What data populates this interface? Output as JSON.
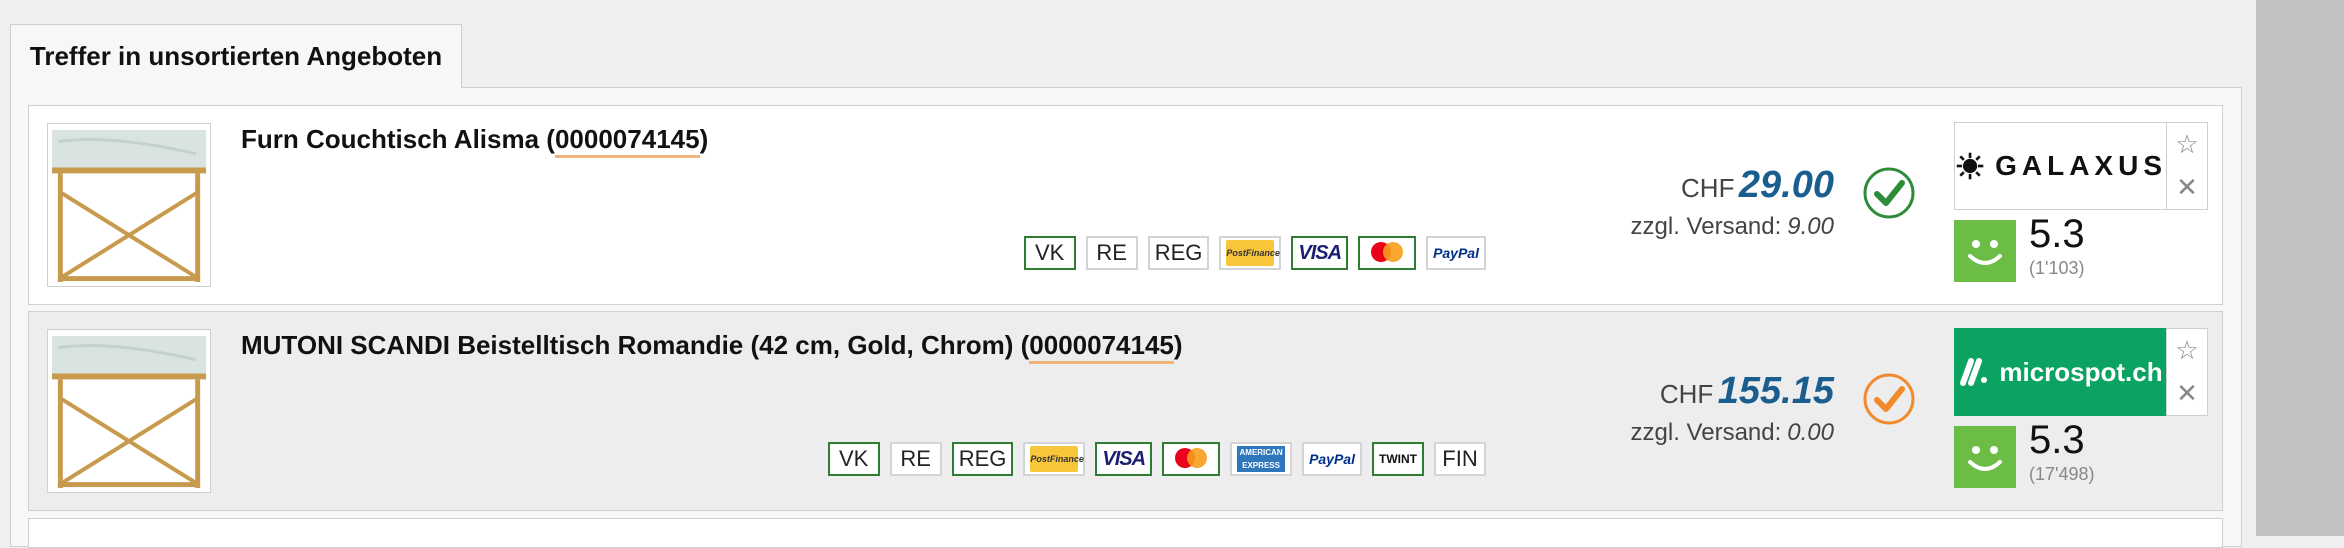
{
  "tab": {
    "label": "Treffer in unsortierten Angeboten"
  },
  "offers": [
    {
      "title": "Furn Couchtisch Alisma (",
      "ean": "0000074145",
      "title_end": ")",
      "payments": [
        {
          "label": "VK",
          "accepted": true
        },
        {
          "label": "RE",
          "accepted": false
        },
        {
          "label": "REG",
          "accepted": false
        },
        {
          "label": "PostFinance",
          "accepted": false
        },
        {
          "label": "VISA",
          "accepted": true
        },
        {
          "label": "mastercard",
          "accepted": true
        },
        {
          "label": "PayPal",
          "accepted": false
        }
      ],
      "currency": "CHF",
      "price": "29.00",
      "shipping_label": "zzgl. Versand:",
      "shipping_value": "9.00",
      "check_color": "#2e8b3a",
      "shop": "GALAXUS",
      "score": "5.3",
      "count": "(1'103)"
    },
    {
      "title": "MUTONI SCANDI Beistelltisch Romandie (42 cm, Gold, Chrom) (",
      "ean": "0000074145",
      "title_end": ")",
      "payments": [
        {
          "label": "VK",
          "accepted": true
        },
        {
          "label": "RE",
          "accepted": false
        },
        {
          "label": "REG",
          "accepted": true
        },
        {
          "label": "PostFinance",
          "accepted": false
        },
        {
          "label": "VISA",
          "accepted": true
        },
        {
          "label": "mastercard",
          "accepted": true
        },
        {
          "label": "AMERICAN EXPRESS",
          "accepted": false
        },
        {
          "label": "PayPal",
          "accepted": false
        },
        {
          "label": "TWINT",
          "accepted": true
        },
        {
          "label": "FIN",
          "accepted": false
        }
      ],
      "currency": "CHF",
      "price": "155.15",
      "shipping_label": "zzgl. Versand:",
      "shipping_value": "0.00",
      "check_color": "#f08a2c",
      "shop": "microspot.ch",
      "score": "5.3",
      "count": "(17'498)"
    }
  ],
  "colors": {
    "price": "#1a5d8f",
    "rating": "#6cbd45",
    "microspot_bg": "#0aa361"
  },
  "icons": [
    "checkmark-icon",
    "star-icon",
    "close-icon",
    "smiley-icon",
    "galaxus-logo-icon"
  ]
}
